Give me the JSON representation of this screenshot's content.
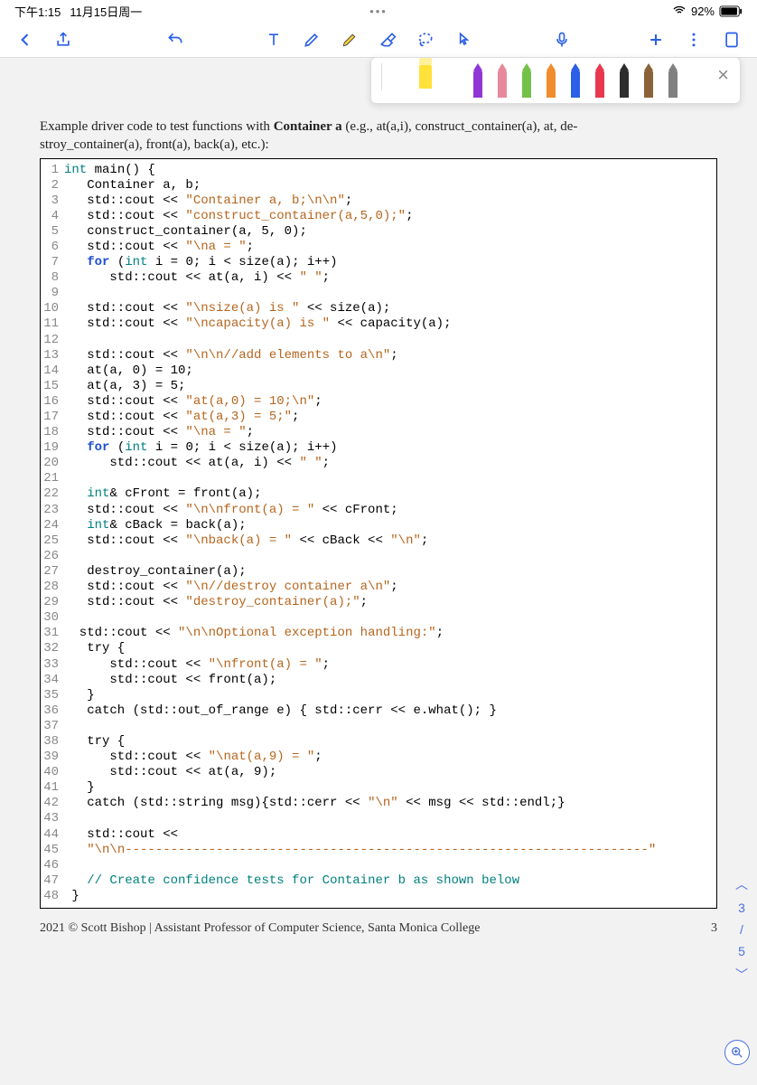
{
  "status": {
    "time": "下午1:15",
    "date": "11月15日周一",
    "dots": "•••",
    "batteryPct": "92%"
  },
  "toolbar": {
    "back": "back-chevron",
    "share": "share-icon",
    "undo": "undo-icon"
  },
  "intro": {
    "line1a": "Example driver code to test functions with ",
    "line1b": "Container a",
    "line1c": " (e.g., at(a,i), construct_container(a), at, de-",
    "line2": "stroy_container(a), front(a), back(a), etc.):"
  },
  "code": {
    "lines": [
      {
        "n": "1",
        "segs": [
          {
            "t": "int",
            "c": "kw-teal"
          },
          {
            "t": " main() {",
            "c": ""
          }
        ]
      },
      {
        "n": "2",
        "segs": [
          {
            "t": "   Container a, b;",
            "c": ""
          }
        ]
      },
      {
        "n": "3",
        "segs": [
          {
            "t": "   std::cout << ",
            "c": ""
          },
          {
            "t": "\"Container a, b;\\n\\n\"",
            "c": "str"
          },
          {
            "t": ";",
            "c": ""
          }
        ]
      },
      {
        "n": "4",
        "segs": [
          {
            "t": "   std::cout << ",
            "c": ""
          },
          {
            "t": "\"construct_container(a,5,0);\"",
            "c": "str"
          },
          {
            "t": ";",
            "c": ""
          }
        ]
      },
      {
        "n": "5",
        "segs": [
          {
            "t": "   construct_container(a, 5, 0);",
            "c": ""
          }
        ]
      },
      {
        "n": "6",
        "segs": [
          {
            "t": "   std::cout << ",
            "c": ""
          },
          {
            "t": "\"\\na = \"",
            "c": "str"
          },
          {
            "t": ";",
            "c": ""
          }
        ]
      },
      {
        "n": "7",
        "segs": [
          {
            "t": "   ",
            "c": ""
          },
          {
            "t": "for",
            "c": "kw-blue"
          },
          {
            "t": " (",
            "c": ""
          },
          {
            "t": "int",
            "c": "kw-teal"
          },
          {
            "t": " i = 0; i < size(a); i++)",
            "c": ""
          }
        ]
      },
      {
        "n": "8",
        "segs": [
          {
            "t": "      std::cout << at(a, i) << ",
            "c": ""
          },
          {
            "t": "\" \"",
            "c": "str"
          },
          {
            "t": ";",
            "c": ""
          }
        ]
      },
      {
        "n": "9",
        "segs": [
          {
            "t": "",
            "c": ""
          }
        ]
      },
      {
        "n": "10",
        "segs": [
          {
            "t": "   std::cout << ",
            "c": ""
          },
          {
            "t": "\"\\nsize(a) is \"",
            "c": "str"
          },
          {
            "t": " << size(a);",
            "c": ""
          }
        ]
      },
      {
        "n": "11",
        "segs": [
          {
            "t": "   std::cout << ",
            "c": ""
          },
          {
            "t": "\"\\ncapacity(a) is \"",
            "c": "str"
          },
          {
            "t": " << capacity(a);",
            "c": ""
          }
        ]
      },
      {
        "n": "12",
        "segs": [
          {
            "t": "",
            "c": ""
          }
        ]
      },
      {
        "n": "13",
        "segs": [
          {
            "t": "   std::cout << ",
            "c": ""
          },
          {
            "t": "\"\\n\\n//add elements to a\\n\"",
            "c": "str"
          },
          {
            "t": ";",
            "c": ""
          }
        ]
      },
      {
        "n": "14",
        "segs": [
          {
            "t": "   at(a, 0) = 10;",
            "c": ""
          }
        ]
      },
      {
        "n": "15",
        "segs": [
          {
            "t": "   at(a, 3) = 5;",
            "c": ""
          }
        ]
      },
      {
        "n": "16",
        "segs": [
          {
            "t": "   std::cout << ",
            "c": ""
          },
          {
            "t": "\"at(a,0) = 10;\\n\"",
            "c": "str"
          },
          {
            "t": ";",
            "c": ""
          }
        ]
      },
      {
        "n": "17",
        "segs": [
          {
            "t": "   std::cout << ",
            "c": ""
          },
          {
            "t": "\"at(a,3) = 5;\"",
            "c": "str"
          },
          {
            "t": ";",
            "c": ""
          }
        ]
      },
      {
        "n": "18",
        "segs": [
          {
            "t": "   std::cout << ",
            "c": ""
          },
          {
            "t": "\"\\na = \"",
            "c": "str"
          },
          {
            "t": ";",
            "c": ""
          }
        ]
      },
      {
        "n": "19",
        "segs": [
          {
            "t": "   ",
            "c": ""
          },
          {
            "t": "for",
            "c": "kw-blue"
          },
          {
            "t": " (",
            "c": ""
          },
          {
            "t": "int",
            "c": "kw-teal"
          },
          {
            "t": " i = 0; i < size(a); i++)",
            "c": ""
          }
        ]
      },
      {
        "n": "20",
        "segs": [
          {
            "t": "      std::cout << at(a, i) << ",
            "c": ""
          },
          {
            "t": "\" \"",
            "c": "str"
          },
          {
            "t": ";",
            "c": ""
          }
        ]
      },
      {
        "n": "21",
        "segs": [
          {
            "t": "",
            "c": ""
          }
        ]
      },
      {
        "n": "22",
        "segs": [
          {
            "t": "   ",
            "c": ""
          },
          {
            "t": "int",
            "c": "kw-teal"
          },
          {
            "t": "& cFront = front(a);",
            "c": ""
          }
        ]
      },
      {
        "n": "23",
        "segs": [
          {
            "t": "   std::cout << ",
            "c": ""
          },
          {
            "t": "\"\\n\\nfront(a) = \"",
            "c": "str"
          },
          {
            "t": " << cFront;",
            "c": ""
          }
        ]
      },
      {
        "n": "24",
        "segs": [
          {
            "t": "   ",
            "c": ""
          },
          {
            "t": "int",
            "c": "kw-teal"
          },
          {
            "t": "& cBack = back(a);",
            "c": ""
          }
        ]
      },
      {
        "n": "25",
        "segs": [
          {
            "t": "   std::cout << ",
            "c": ""
          },
          {
            "t": "\"\\nback(a) = \"",
            "c": "str"
          },
          {
            "t": " << cBack << ",
            "c": ""
          },
          {
            "t": "\"\\n\"",
            "c": "str"
          },
          {
            "t": ";",
            "c": ""
          }
        ]
      },
      {
        "n": "26",
        "segs": [
          {
            "t": "",
            "c": ""
          }
        ]
      },
      {
        "n": "27",
        "segs": [
          {
            "t": "   destroy_container(a);",
            "c": ""
          }
        ]
      },
      {
        "n": "28",
        "segs": [
          {
            "t": "   std::cout << ",
            "c": ""
          },
          {
            "t": "\"\\n//destroy container a\\n\"",
            "c": "str"
          },
          {
            "t": ";",
            "c": ""
          }
        ]
      },
      {
        "n": "29",
        "segs": [
          {
            "t": "   std::cout << ",
            "c": ""
          },
          {
            "t": "\"destroy_container(a);\"",
            "c": "str"
          },
          {
            "t": ";",
            "c": ""
          }
        ]
      },
      {
        "n": "30",
        "segs": [
          {
            "t": "",
            "c": ""
          }
        ]
      },
      {
        "n": "31",
        "segs": [
          {
            "t": "  std::cout << ",
            "c": ""
          },
          {
            "t": "\"\\n\\nOptional exception handling:\"",
            "c": "str"
          },
          {
            "t": ";",
            "c": ""
          }
        ]
      },
      {
        "n": "32",
        "segs": [
          {
            "t": "   try {",
            "c": ""
          }
        ]
      },
      {
        "n": "33",
        "segs": [
          {
            "t": "      std::cout << ",
            "c": ""
          },
          {
            "t": "\"\\nfront(a) = \"",
            "c": "str"
          },
          {
            "t": ";",
            "c": ""
          }
        ]
      },
      {
        "n": "34",
        "segs": [
          {
            "t": "      std::cout << front(a);",
            "c": ""
          }
        ]
      },
      {
        "n": "35",
        "segs": [
          {
            "t": "   }",
            "c": ""
          }
        ]
      },
      {
        "n": "36",
        "segs": [
          {
            "t": "   catch (std::out_of_range e) { std::cerr << e.what(); }",
            "c": ""
          }
        ]
      },
      {
        "n": "37",
        "segs": [
          {
            "t": "",
            "c": ""
          }
        ]
      },
      {
        "n": "38",
        "segs": [
          {
            "t": "   try {",
            "c": ""
          }
        ]
      },
      {
        "n": "39",
        "segs": [
          {
            "t": "      std::cout << ",
            "c": ""
          },
          {
            "t": "\"\\nat(a,9) = \"",
            "c": "str"
          },
          {
            "t": ";",
            "c": ""
          }
        ]
      },
      {
        "n": "40",
        "segs": [
          {
            "t": "      std::cout << at(a, 9);",
            "c": ""
          }
        ]
      },
      {
        "n": "41",
        "segs": [
          {
            "t": "   }",
            "c": ""
          }
        ]
      },
      {
        "n": "42",
        "segs": [
          {
            "t": "   catch (std::string msg){std::cerr << ",
            "c": ""
          },
          {
            "t": "\"\\n\"",
            "c": "str"
          },
          {
            "t": " << msg << std::endl;}",
            "c": ""
          }
        ]
      },
      {
        "n": "43",
        "segs": [
          {
            "t": "",
            "c": ""
          }
        ]
      },
      {
        "n": "44",
        "segs": [
          {
            "t": "   std::cout <<",
            "c": ""
          }
        ]
      },
      {
        "n": "45",
        "segs": [
          {
            "t": "   ",
            "c": ""
          },
          {
            "t": "\"\\n\\n---------------------------------------------------------------------\"",
            "c": "str"
          }
        ]
      },
      {
        "n": "46",
        "segs": [
          {
            "t": "",
            "c": ""
          }
        ]
      },
      {
        "n": "47",
        "segs": [
          {
            "t": "   ",
            "c": ""
          },
          {
            "t": "// Create confidence tests for Container b as shown below",
            "c": "kw-teal"
          }
        ]
      },
      {
        "n": "48",
        "segs": [
          {
            "t": " }",
            "c": ""
          }
        ]
      }
    ]
  },
  "footer": {
    "left": "2021 © Scott Bishop | Assistant Professor of Computer Science, Santa Monica College",
    "right": "3"
  },
  "rail": {
    "up": "︿",
    "v1": "3",
    "v2": "/",
    "v3": "5",
    "down": "﹀"
  },
  "pens": {
    "colors": [
      "#9136d6",
      "#e8899b",
      "#74c14a",
      "#f08c2e",
      "#2b5fe8",
      "#e8384f",
      "#2d2d2d",
      "#8c6239",
      "#808080"
    ]
  }
}
